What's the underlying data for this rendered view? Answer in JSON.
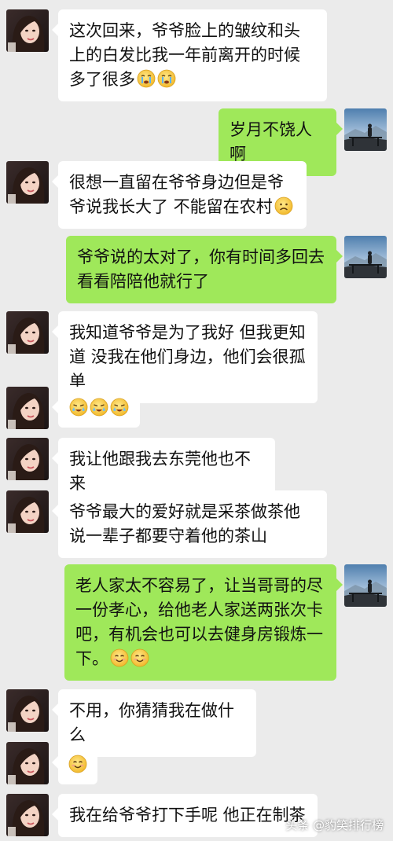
{
  "messages": [
    {
      "side": "in",
      "text": "这次回来，爷爷脸上的皱纹和头上的白发比我一年前离开的时候多了很多",
      "emoji": [
        "cry-emoji",
        "cry-emoji"
      ]
    },
    {
      "side": "out",
      "text": "岁月不饶人啊"
    },
    {
      "side": "in",
      "text": "很想一直留在爷爷身边但是爷爷说我长大了 不能留在农村",
      "emoji": [
        "sad-emoji"
      ]
    },
    {
      "side": "out",
      "text": "爷爷说的太对了，你有时间多回去看看陪陪他就行了"
    },
    {
      "side": "in",
      "text": "我知道爷爷是为了我好  但我更知道 没我在他们身边，他们会很孤单"
    },
    {
      "side": "in",
      "text": "",
      "emoji": [
        "sob-emoji",
        "sob-emoji",
        "sob-emoji"
      ]
    },
    {
      "side": "in",
      "text": "我让他跟我去东莞他也不来"
    },
    {
      "side": "in",
      "text": "爷爷最大的爱好就是采茶做茶他说一辈子都要守着他的茶山"
    },
    {
      "side": "out",
      "text": "老人家太不容易了，让当哥哥的尽一份孝心，给他老人家送两张次卡吧，有机会也可以去健身房锻炼一下。",
      "emoji": [
        "smile-emoji",
        "smile-emoji"
      ]
    },
    {
      "side": "in",
      "text": "不用，你猜猜我在做什么"
    },
    {
      "side": "in",
      "text": "",
      "emoji": [
        "smile-emoji"
      ]
    },
    {
      "side": "in",
      "text": "我在给爷爷打下手呢  他正在制茶"
    }
  ],
  "watermark": "头条 @豹笑排行榜",
  "colors": {
    "background": "#ebebeb",
    "incoming_bubble": "#ffffff",
    "outgoing_bubble": "#9fe85a"
  }
}
